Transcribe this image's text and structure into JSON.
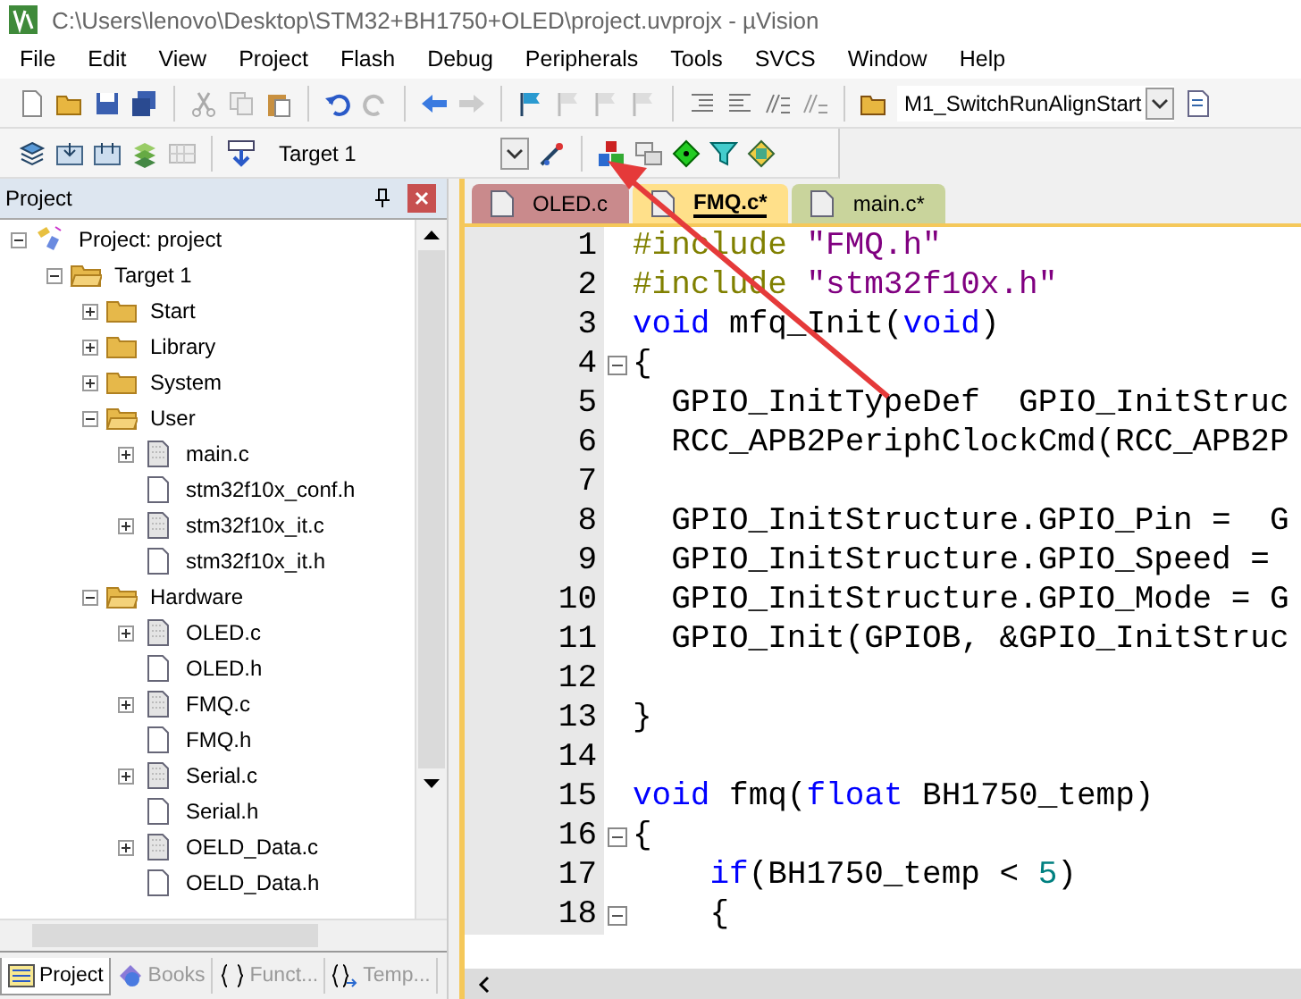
{
  "window": {
    "title": "C:\\Users\\lenovo\\Desktop\\STM32+BH1750+OLED\\project.uvprojx - µVision"
  },
  "menu": [
    "File",
    "Edit",
    "View",
    "Project",
    "Flash",
    "Debug",
    "Peripherals",
    "Tools",
    "SVCS",
    "Window",
    "Help"
  ],
  "toolbar": {
    "function_select": "M1_SwitchRunAlignStart",
    "target_select": "Target 1"
  },
  "project_panel": {
    "title": "Project",
    "tree": [
      {
        "label": "Project: project",
        "kind": "project",
        "expanded": true,
        "children": [
          {
            "label": "Target 1",
            "kind": "target",
            "expanded": true,
            "children": [
              {
                "label": "Start",
                "kind": "folder",
                "expanded": false
              },
              {
                "label": "Library",
                "kind": "folder",
                "expanded": false
              },
              {
                "label": "System",
                "kind": "folder",
                "expanded": false
              },
              {
                "label": "User",
                "kind": "folder",
                "expanded": true,
                "children": [
                  {
                    "label": "main.c",
                    "kind": "source",
                    "expanded": false
                  },
                  {
                    "label": "stm32f10x_conf.h",
                    "kind": "header"
                  },
                  {
                    "label": "stm32f10x_it.c",
                    "kind": "source",
                    "expanded": false
                  },
                  {
                    "label": "stm32f10x_it.h",
                    "kind": "header"
                  }
                ]
              },
              {
                "label": "Hardware",
                "kind": "folder",
                "expanded": true,
                "children": [
                  {
                    "label": "OLED.c",
                    "kind": "source",
                    "expanded": false
                  },
                  {
                    "label": "OLED.h",
                    "kind": "header"
                  },
                  {
                    "label": "FMQ.c",
                    "kind": "source",
                    "expanded": false
                  },
                  {
                    "label": "FMQ.h",
                    "kind": "header"
                  },
                  {
                    "label": "Serial.c",
                    "kind": "source",
                    "expanded": false
                  },
                  {
                    "label": "Serial.h",
                    "kind": "header"
                  },
                  {
                    "label": "OELD_Data.c",
                    "kind": "source",
                    "expanded": false
                  },
                  {
                    "label": "OELD_Data.h",
                    "kind": "header"
                  }
                ]
              }
            ]
          }
        ]
      }
    ],
    "tabs": [
      {
        "label": "Project",
        "selected": true
      },
      {
        "label": "Books",
        "selected": false
      },
      {
        "label": "Funct...",
        "selected": false
      },
      {
        "label": "Temp...",
        "selected": false
      }
    ]
  },
  "editor": {
    "tabs": [
      {
        "label": "OLED.c",
        "selected": false,
        "color": "#c98a8c"
      },
      {
        "label": "FMQ.c*",
        "selected": true,
        "color": "#ffe08a"
      },
      {
        "label": "main.c*",
        "selected": false,
        "color": "#c9d49c"
      }
    ],
    "lines": [
      {
        "number": "1",
        "fold": false,
        "tokens": [
          {
            "text": "#include ",
            "kind": "preproc"
          },
          {
            "text": "\"FMQ.h\"",
            "kind": "string"
          }
        ]
      },
      {
        "number": "2",
        "fold": false,
        "tokens": [
          {
            "text": "#include ",
            "kind": "preproc"
          },
          {
            "text": "\"stm32f10x.h\"",
            "kind": "string"
          }
        ]
      },
      {
        "number": "3",
        "fold": false,
        "tokens": [
          {
            "text": "void",
            "kind": "keyword"
          },
          {
            "text": " mfq_Init(",
            "kind": "plain"
          },
          {
            "text": "void",
            "kind": "keyword"
          },
          {
            "text": ")",
            "kind": "plain"
          }
        ]
      },
      {
        "number": "4",
        "fold": true,
        "tokens": [
          {
            "text": "{",
            "kind": "plain"
          }
        ]
      },
      {
        "number": "5",
        "fold": false,
        "tokens": [
          {
            "text": "  GPIO_InitTypeDef  GPIO_InitStruc",
            "kind": "plain"
          }
        ]
      },
      {
        "number": "6",
        "fold": false,
        "tokens": [
          {
            "text": "  RCC_APB2PeriphClockCmd(RCC_APB2P",
            "kind": "plain"
          }
        ]
      },
      {
        "number": "7",
        "fold": false
      },
      {
        "number": "8",
        "fold": false,
        "tokens": [
          {
            "text": "  GPIO_InitStructure.GPIO_Pin =  G",
            "kind": "plain"
          }
        ]
      },
      {
        "number": "9",
        "fold": false,
        "tokens": [
          {
            "text": "  GPIO_InitStructure.GPIO_Speed = ",
            "kind": "plain"
          }
        ]
      },
      {
        "number": "10",
        "fold": false,
        "tokens": [
          {
            "text": "  GPIO_InitStructure.GPIO_Mode = G",
            "kind": "plain"
          }
        ]
      },
      {
        "number": "11",
        "fold": false,
        "tokens": [
          {
            "text": "  GPIO_Init(GPIOB, &GPIO_InitStruc",
            "kind": "plain"
          }
        ]
      },
      {
        "number": "12",
        "fold": false
      },
      {
        "number": "13",
        "fold": false,
        "tokens": [
          {
            "text": "}",
            "kind": "plain"
          }
        ]
      },
      {
        "number": "14",
        "fold": false
      },
      {
        "number": "15",
        "fold": false,
        "tokens": [
          {
            "text": "void",
            "kind": "keyword"
          },
          {
            "text": " fmq(",
            "kind": "plain"
          },
          {
            "text": "float",
            "kind": "keyword"
          },
          {
            "text": " BH1750_temp)",
            "kind": "plain"
          }
        ]
      },
      {
        "number": "16",
        "fold": true,
        "tokens": [
          {
            "text": "{",
            "kind": "plain"
          }
        ]
      },
      {
        "number": "17",
        "fold": false,
        "tokens": [
          {
            "text": "    if",
            "kind": "keyword"
          },
          {
            "text": "(BH1750_temp < ",
            "kind": "plain"
          },
          {
            "text": "5",
            "kind": "number"
          },
          {
            "text": ")",
            "kind": "plain"
          }
        ]
      },
      {
        "number": "18",
        "fold": true,
        "tokens": [
          {
            "text": "    {",
            "kind": "plain"
          }
        ]
      }
    ]
  }
}
